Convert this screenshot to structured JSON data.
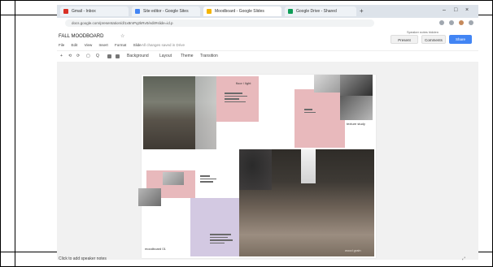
{
  "window": {
    "tabs": [
      {
        "label": "Gmail - Inbox",
        "color": "#d93025"
      },
      {
        "label": "Site editor - Google Sites",
        "color": "#4285f4"
      },
      {
        "label": "Moodboard - Google Slides",
        "color": "#f4b400"
      },
      {
        "label": "Google Drive - Shared",
        "color": "#0f9d58"
      }
    ],
    "new_tab_glyph": "+",
    "controls": [
      "–",
      "□",
      "×"
    ]
  },
  "browser": {
    "url": "docs.google.com/presentation/d/1x8mPq2kRv0/edit#slide=id.p"
  },
  "app": {
    "title": "FALL MOODBOARD",
    "star_glyph": "☆",
    "menus": [
      "File",
      "Edit",
      "View",
      "Insert",
      "Format",
      "Slide"
    ],
    "saved_status": "All changes saved in Drive",
    "present_label": "Present",
    "comments_label": "Comments",
    "share_label": "Share",
    "top_link": "Speaker notes hidden"
  },
  "toolbar": {
    "items": [
      "+",
      "⟲",
      "⟳",
      "▢",
      "Q",
      "Background",
      "Layout",
      "Theme",
      "Transition"
    ]
  },
  "slide": {
    "captions": {
      "top_right": "floor / light",
      "mid_left": "texture study",
      "bottom_left": "moodboard 01",
      "bottom_right": "wood grain"
    }
  },
  "status": {
    "left": "Click to add speaker notes",
    "right": "⤢"
  },
  "colors": {
    "pink": "#e8b9bc",
    "lavender": "#d3c9e2",
    "photo_dark": "#4d4a43",
    "wood": "#8b7f73",
    "accent": "#4285f4"
  }
}
